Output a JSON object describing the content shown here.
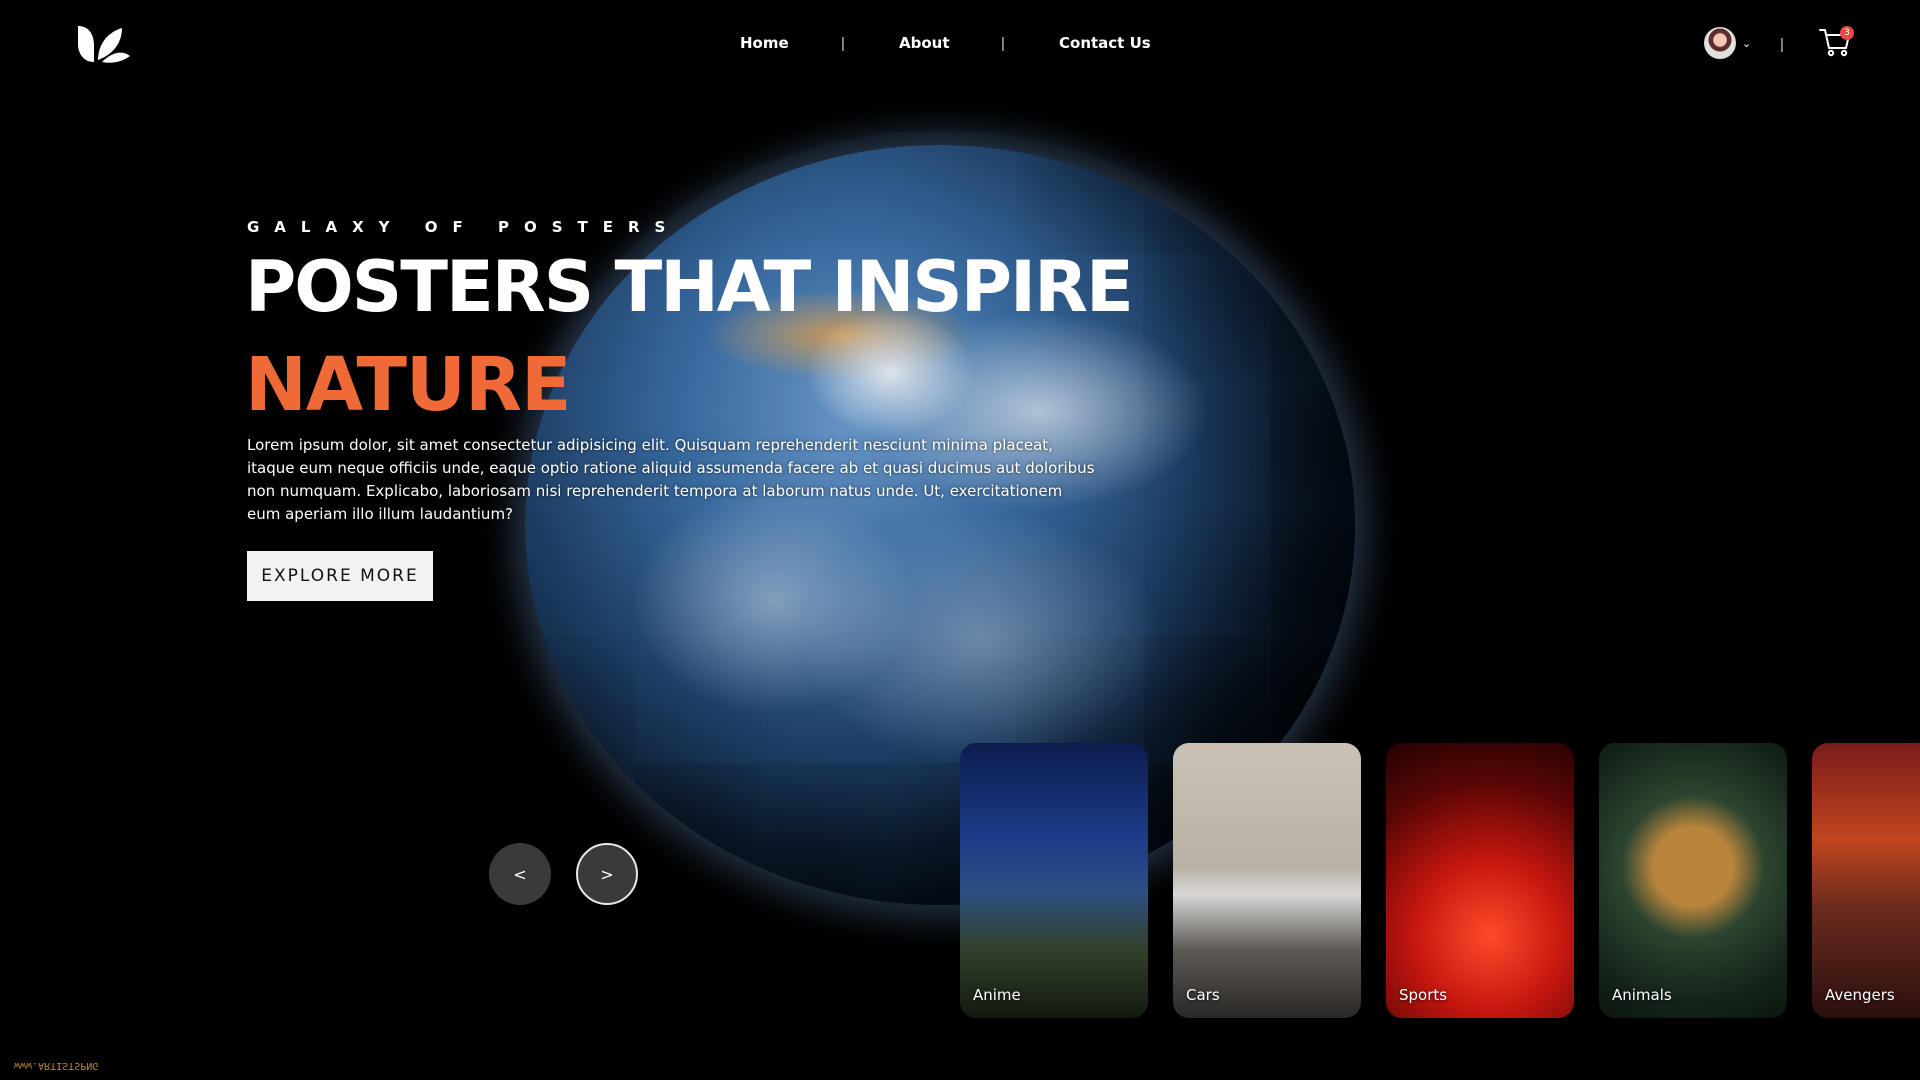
{
  "header": {
    "logo_icon": "k-leaf-logo-icon",
    "nav": [
      {
        "label": "Home"
      },
      {
        "label": "About"
      },
      {
        "label": "Contact Us"
      }
    ],
    "separator": "|",
    "user_chevron": "⌄",
    "cart_icon": "shopping-cart-icon",
    "cart_count": "3"
  },
  "hero": {
    "eyebrow": "GALAXY OF POSTERS",
    "title": "POSTERS THAT INSPIRE",
    "subtitle": "NATURE",
    "accent_color": "#f06a37",
    "description": "Lorem ipsum dolor, sit amet consectetur adipisicing elit. Quisquam reprehenderit nesciunt minima placeat, itaque eum neque officiis unde, eaque optio ratione aliquid assumenda facere ab et quasi ducimus aut doloribus non numquam. Explicabo, laboriosam nisi reprehenderit tempora at laborum natus unde. Ut, exercitationem eum aperiam illo illum laudantium?",
    "cta_label": "EXPLORE MORE"
  },
  "carousel": {
    "prev_label": "<",
    "next_label": ">",
    "cards": [
      {
        "label": "Anime"
      },
      {
        "label": "Cars"
      },
      {
        "label": "Sports"
      },
      {
        "label": "Animals"
      },
      {
        "label": "Avengers"
      }
    ]
  },
  "watermark": "www.ARTISTSPNG"
}
